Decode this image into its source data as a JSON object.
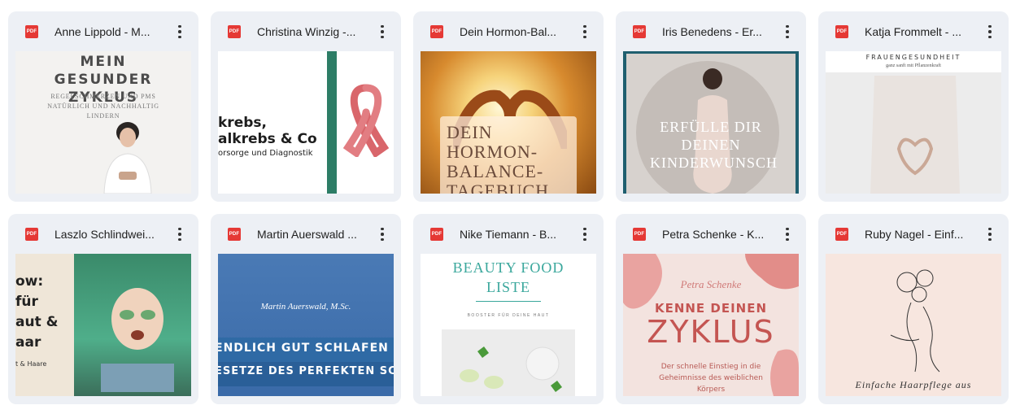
{
  "files": [
    {
      "title": "Anne Lippold - M...",
      "type_badge": "PDF",
      "thumb": {
        "heading": "MEIN GESUNDER ZYKLUS",
        "subheading": "REGELSCHMERZEN UND PMS NATÜRLICH UND NACHHALTIG LINDERN"
      }
    },
    {
      "title": "Christina Winzig -...",
      "type_badge": "PDF",
      "thumb": {
        "line1": "krebs,",
        "line2": "alkrebs & Co",
        "line3": "orsorge und Diagnostik"
      }
    },
    {
      "title": "Dein Hormon-Bal...",
      "type_badge": "PDF",
      "thumb": {
        "heading": "DEIN HORMON- BALANCE- TAGEBUCH"
      }
    },
    {
      "title": "Iris Benedens - Er...",
      "type_badge": "PDF",
      "thumb": {
        "heading": "ERFÜLLE DIR DEINEN KINDERWUNSCH"
      }
    },
    {
      "title": "Katja Frommelt - ...",
      "type_badge": "PDF",
      "thumb": {
        "heading": "FRAUENGESUNDHEIT",
        "subheading": "ganz sanft mit Pflanzenkraft"
      }
    },
    {
      "title": "Laszlo Schlindwei...",
      "type_badge": "PDF",
      "thumb": {
        "line1": "ow:",
        "line2": "für",
        "line3": "aut &",
        "line4": "aar",
        "sub": "t & Haare"
      }
    },
    {
      "title": "Martin Auerswald ...",
      "type_badge": "PDF",
      "thumb": {
        "name": "Martin Auerswald, M.Sc.",
        "line1": "ENDLICH GUT SCHLAFEN",
        "line2": "ESETZE DES PERFEKTEN SC"
      }
    },
    {
      "title": "Nike Tiemann - B...",
      "type_badge": "PDF",
      "thumb": {
        "heading": "BEAUTY FOOD LISTE",
        "subheading": "BOOSTER FÜR DEINE HAUT"
      }
    },
    {
      "title": "Petra Schenke - K...",
      "type_badge": "PDF",
      "thumb": {
        "name": "Petra Schenke",
        "line1": "KENNE DEINEN",
        "line2": "ZYKLUS",
        "sub": "Der schnelle Einstieg in die Geheimnisse des weiblichen Körpers"
      }
    },
    {
      "title": "Ruby Nagel - Einf...",
      "type_badge": "PDF",
      "thumb": {
        "caption": "Einfache Haarpflege aus"
      }
    }
  ],
  "colors": {
    "card_bg": "#edf0f5",
    "pdf_red": "#e53935",
    "title_text": "#1f1f1f"
  }
}
